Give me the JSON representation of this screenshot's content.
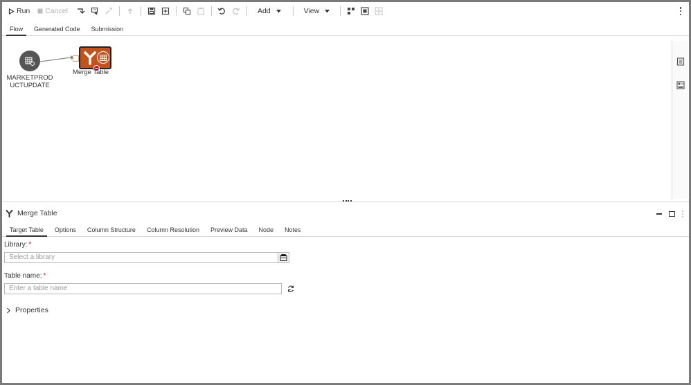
{
  "toolbar": {
    "run_label": "Run",
    "cancel_label": "Cancel",
    "add_label": "Add",
    "view_label": "View"
  },
  "top_tabs": [
    {
      "label": "Flow",
      "active": true
    },
    {
      "label": "Generated Code",
      "active": false
    },
    {
      "label": "Submission",
      "active": false
    }
  ],
  "canvas": {
    "source_node_label_line1": "MARKETPROD",
    "source_node_label_line2": "UCTUPDATE",
    "merge_node_label": "Merge Table",
    "merge_node_color": "#c2531c"
  },
  "panel": {
    "title": "Merge Table",
    "tabs": [
      {
        "label": "Target Table",
        "active": true
      },
      {
        "label": "Options",
        "active": false
      },
      {
        "label": "Column Structure",
        "active": false
      },
      {
        "label": "Column Resolution",
        "active": false
      },
      {
        "label": "Preview Data",
        "active": false
      },
      {
        "label": "Node",
        "active": false
      },
      {
        "label": "Notes",
        "active": false
      }
    ],
    "library_label": "Library:",
    "library_placeholder": "Select a library",
    "table_label": "Table name:",
    "table_placeholder": "Enter a table name",
    "required_mark": "*",
    "properties_label": "Properties"
  },
  "colors": {
    "accent_orange": "#c2531c",
    "required_red": "#c8102e"
  }
}
